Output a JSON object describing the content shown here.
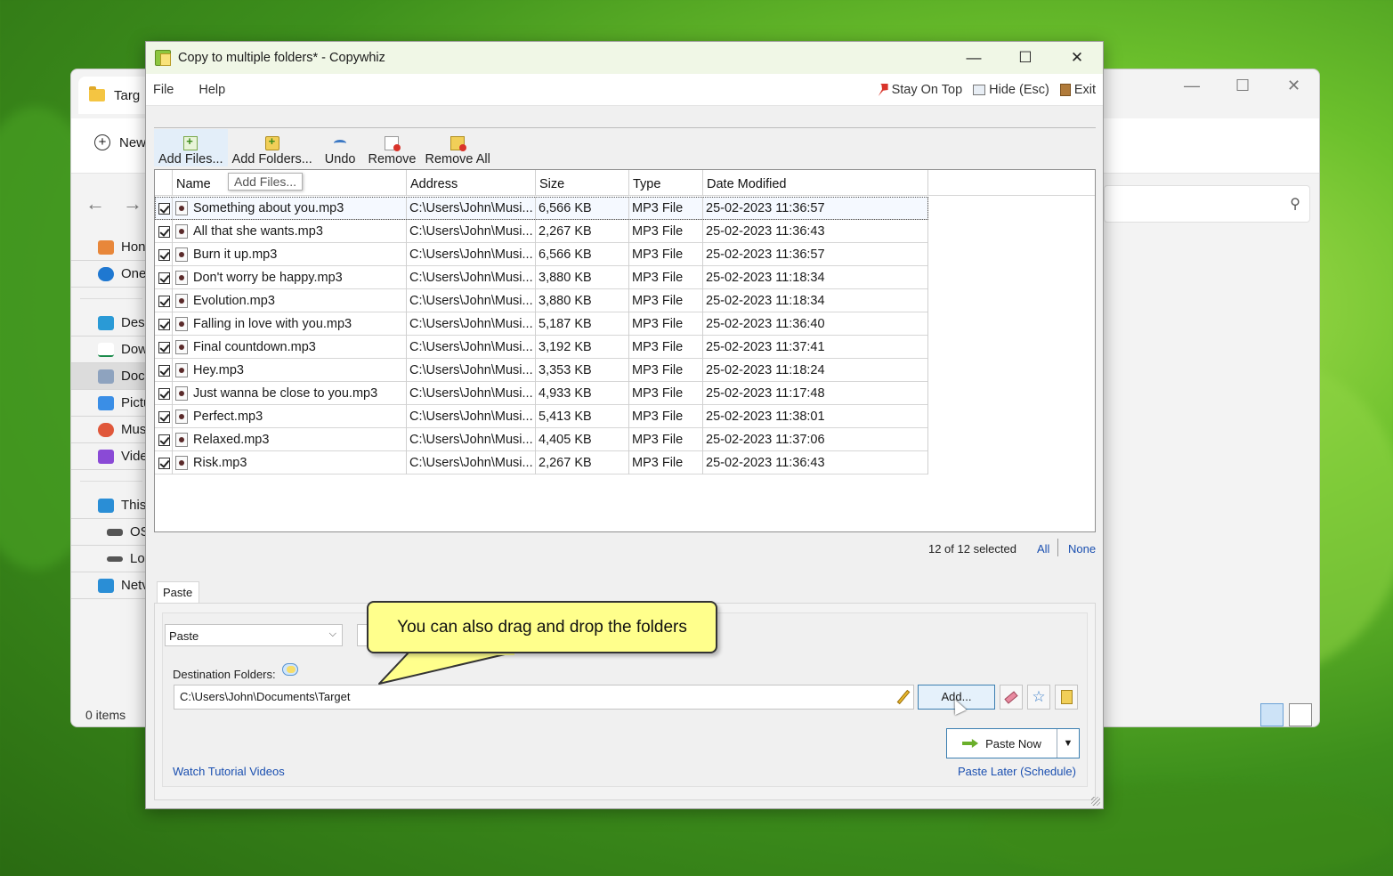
{
  "explorer": {
    "tab_title": "Targ",
    "new_label": "New",
    "sidebar": [
      "Hon",
      "One",
      "Desl",
      "Dow",
      "Doc",
      "Pictu",
      "Mus",
      "Vide",
      "This",
      "OS",
      "Lo",
      "Netv"
    ],
    "status": "0 items"
  },
  "app": {
    "title": "Copy to multiple folders* - Copywhiz",
    "menu": {
      "file": "File",
      "help": "Help"
    },
    "menu_right": {
      "stay_on_top": "Stay On Top",
      "hide": "Hide (Esc)",
      "exit": "Exit"
    },
    "toolbar": {
      "add_files": "Add Files...",
      "add_folders": "Add Folders...",
      "undo": "Undo",
      "remove": "Remove",
      "remove_all": "Remove All"
    },
    "tooltip": "Add Files...",
    "columns": {
      "name": "Name",
      "address": "Address",
      "size": "Size",
      "type": "Type",
      "date": "Date Modified"
    },
    "rows": [
      {
        "name": "Something about you.mp3",
        "address": "C:\\Users\\John\\Musi...",
        "size": "6,566 KB",
        "type": "MP3 File",
        "date": "25-02-2023 11:36:57"
      },
      {
        "name": "All that she wants.mp3",
        "address": "C:\\Users\\John\\Musi...",
        "size": "2,267 KB",
        "type": "MP3 File",
        "date": "25-02-2023 11:36:43"
      },
      {
        "name": "Burn it up.mp3",
        "address": "C:\\Users\\John\\Musi...",
        "size": "6,566 KB",
        "type": "MP3 File",
        "date": "25-02-2023 11:36:57"
      },
      {
        "name": "Don't worry be happy.mp3",
        "address": "C:\\Users\\John\\Musi...",
        "size": "3,880 KB",
        "type": "MP3 File",
        "date": "25-02-2023 11:18:34"
      },
      {
        "name": "Evolution.mp3",
        "address": "C:\\Users\\John\\Musi...",
        "size": "3,880 KB",
        "type": "MP3 File",
        "date": "25-02-2023 11:18:34"
      },
      {
        "name": "Falling in love with you.mp3",
        "address": "C:\\Users\\John\\Musi...",
        "size": "5,187 KB",
        "type": "MP3 File",
        "date": "25-02-2023 11:36:40"
      },
      {
        "name": "Final countdown.mp3",
        "address": "C:\\Users\\John\\Musi...",
        "size": "3,192 KB",
        "type": "MP3 File",
        "date": "25-02-2023 11:37:41"
      },
      {
        "name": "Hey.mp3",
        "address": "C:\\Users\\John\\Musi...",
        "size": "3,353 KB",
        "type": "MP3 File",
        "date": "25-02-2023 11:18:24"
      },
      {
        "name": "Just wanna be close to you.mp3",
        "address": "C:\\Users\\John\\Musi...",
        "size": "4,933 KB",
        "type": "MP3 File",
        "date": "25-02-2023 11:17:48"
      },
      {
        "name": "Perfect.mp3",
        "address": "C:\\Users\\John\\Musi...",
        "size": "5,413 KB",
        "type": "MP3 File",
        "date": "25-02-2023 11:38:01"
      },
      {
        "name": "Relaxed.mp3",
        "address": "C:\\Users\\John\\Musi...",
        "size": "4,405 KB",
        "type": "MP3 File",
        "date": "25-02-2023 11:37:06"
      },
      {
        "name": "Risk.mp3",
        "address": "C:\\Users\\John\\Musi...",
        "size": "2,267 KB",
        "type": "MP3 File",
        "date": "25-02-2023 11:36:43"
      }
    ],
    "selection": {
      "info": "12 of 12 selected",
      "all": "All",
      "none": "None"
    },
    "paste": {
      "tab": "Paste",
      "mode": "Paste",
      "dest_label": "Destination Folders:",
      "dest_value": "C:\\Users\\John\\Documents\\Target",
      "add_button": "Add...",
      "paste_now": "Paste Now",
      "tutorial_link": "Watch Tutorial Videos",
      "paste_later_link": "Paste Later (Schedule)"
    },
    "balloon": "You can also drag and drop the folders"
  }
}
